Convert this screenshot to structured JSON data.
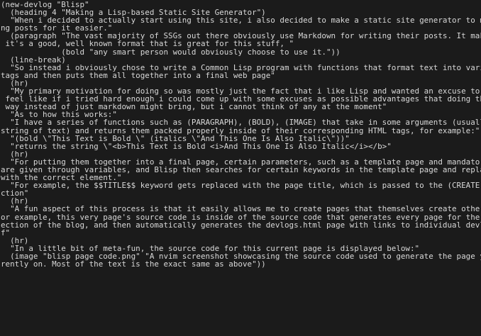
{
  "editor": {
    "lines": [
      "(new-devlog \"Blisp\"",
      "  (heading 4 \"Making a Lisp-based Static Site Generator\")",
      "  \"When i decided to actually start using this site, i also decided to make a static site generator to make writi",
      "ng posts for it easier.\"",
      "  (paragraph \"The vast majority of SSGs out there obviously use Markdown for writing their posts. It makes sense,",
      " it's a good, well known format that is great for this stuff, \"",
      "             (bold \"any smart person would obviously choose to use it.\"))",
      "  (line-break)",
      "  \"So instead i obviously chose to write a Common Lisp program with functions that format text into various HTML",
      "tags and then puts them all together into a final web page\"",
      "  (hr)",
      "  \"My primary motivation for doing so was mostly just the fact that i like Lisp and wanted an excuse to use it. I",
      " feel like if i tried hard enough i could come up with some excuses as possible advantages that doing things this",
      " way instead of just markdown might bring, but i cannot think of any at the moment\"",
      "  \"As to how this works:\"",
      "  \"I have a series of functions such as (PARAGRAPH), (BOLD), (IMAGE) that take in some arguments (usually just a",
      "string of text) and returns them packed properly inside of their corresponding HTML tags, for example:\"",
      "  \"(bold \\\"This Text is Bold \\\" (italics \\\"And This One Is Also Italic\\\"))\"",
      "  \"returns the string \\\"<b>This Text is Bold <i>And This One Is Also Italic</i></b>\"",
      "  (hr)",
      "  \"For putting them together into a final page, certain parameters, such as a template page and mandatory paths,",
      "are given through variables, and Blisp then searches for certain keywords in the template page and replaces them",
      "with the correct element.\"",
      "  \"For example, the $$TITLE$$ keyword gets replaced with the page title, which is passed to the (CREATE-POST) fun",
      "ction\"",
      "  (hr)",
      "  \"A fun aspect of this process is that it easily allows me to create pages that themselves create other pages. F",
      "or example, this very page's source code is inside of the source code that generates every page for the Devlogs s",
      "ection of the blog, and then automatically generates the devlogs.html page with links to individual devlogs itsel",
      "f\"",
      "  (hr)",
      "  \"In a little bit of meta-fun, the source code for this current page is displayed below:\"",
      "  (image \"blisp_page_code.png\" \"A nvim screenshot showcasing the source code used to generate the page you're cur",
      "rently on. Most of the text is the exact same as above\"))"
    ]
  }
}
